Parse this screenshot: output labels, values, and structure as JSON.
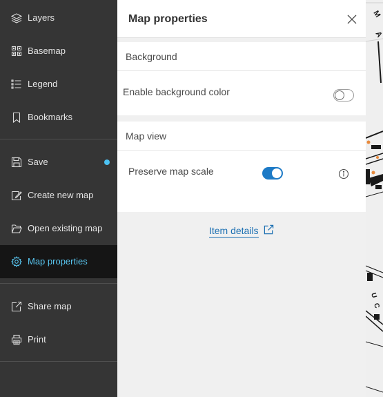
{
  "nav": {
    "items": [
      {
        "label": "Layers"
      },
      {
        "label": "Basemap"
      },
      {
        "label": "Legend"
      },
      {
        "label": "Bookmarks"
      },
      {
        "label": "Save"
      },
      {
        "label": "Create new map"
      },
      {
        "label": "Open existing map"
      },
      {
        "label": "Map properties"
      },
      {
        "label": "Share map"
      },
      {
        "label": "Print"
      }
    ],
    "active_item": "Map properties"
  },
  "panel": {
    "title": "Map properties",
    "background_section": {
      "heading": "Background",
      "enable_bg_label": "Enable background color",
      "enable_bg_on": false
    },
    "map_view_section": {
      "heading": "Map view",
      "preserve_scale_label": "Preserve map scale",
      "preserve_scale_on": true
    },
    "item_details_link": "Item details"
  },
  "colors": {
    "nav_bg": "#353535",
    "active_accent": "#59c6f0",
    "toggle_on": "#1d7ac6",
    "link": "#1b6fb2"
  }
}
